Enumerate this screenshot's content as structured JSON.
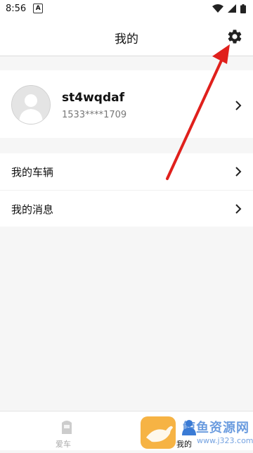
{
  "status_bar": {
    "time": "8:56",
    "notification_glyph": "A"
  },
  "header": {
    "title": "我的",
    "settings_icon": "gear-icon"
  },
  "profile": {
    "username": "st4wqdaf",
    "phone": "1533****1709"
  },
  "menu": [
    {
      "label": "我的车辆"
    },
    {
      "label": "我的消息"
    }
  ],
  "tabs": [
    {
      "label": "爱车",
      "icon": "car-icon"
    },
    {
      "label": "我的",
      "icon": "user-icon"
    }
  ],
  "watermark": {
    "name": "鲸鱼资源网",
    "url": "www.j323.com"
  },
  "colors": {
    "annotation_arrow": "#e0201c",
    "accent": "#3a7bd5",
    "page_bg": "#f6f6f6"
  }
}
